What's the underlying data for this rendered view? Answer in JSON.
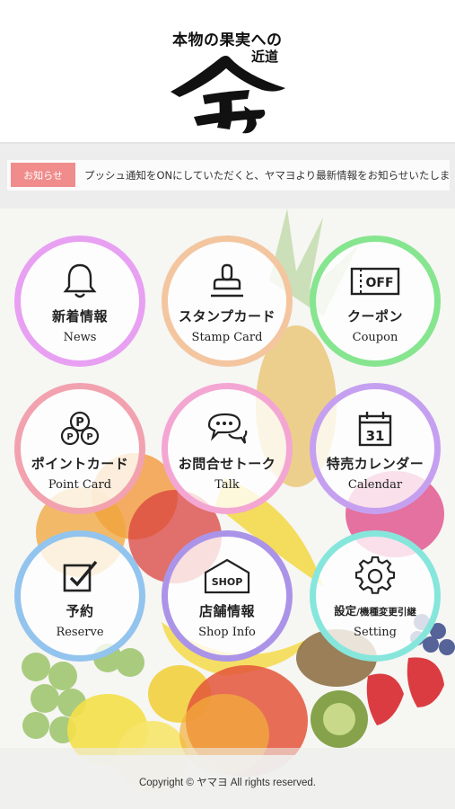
{
  "header": {
    "tagline_line1": "本物の果実への",
    "tagline_line2": "近道"
  },
  "notice": {
    "label": "お知らせ",
    "text": "プッシュ通知をONにしていただくと、ヤマヨより最新情報をお知らせいたします"
  },
  "menu": [
    {
      "ja": "新着情報",
      "en": "News",
      "icon": "bell-icon",
      "color": "#e38ff0"
    },
    {
      "ja": "スタンプカード",
      "en": "Stamp Card",
      "icon": "stamp-icon",
      "color": "#f3c29b"
    },
    {
      "ja": "クーポン",
      "en": "Coupon",
      "icon": "coupon-icon",
      "color": "#7de08a"
    },
    {
      "ja": "ポイントカード",
      "en": "Point Card",
      "icon": "points-icon",
      "color": "#f09aa8"
    },
    {
      "ja": "お問合せトーク",
      "en": "Talk",
      "icon": "chat-icon",
      "color": "#f3a0cf"
    },
    {
      "ja": "特売カレンダー",
      "en": "Calendar",
      "icon": "calendar-icon",
      "color": "#c39af0"
    },
    {
      "ja": "予約",
      "en": "Reserve",
      "icon": "checkbox-icon",
      "color": "#8ec0ec"
    },
    {
      "ja": "店舗情報",
      "en": "Shop Info",
      "icon": "shop-icon",
      "color": "#a88fe6"
    },
    {
      "ja_main": "設定",
      "ja_sub": "/機種変更引継",
      "en": "Setting",
      "icon": "gear-icon",
      "color": "#7fe3d9"
    }
  ],
  "icon_text": {
    "coupon": "OFF",
    "calendar": "31",
    "shop": "SHOP",
    "points": "P"
  },
  "footer": {
    "copyright": "Copyright © ヤマヨ All rights reserved."
  }
}
